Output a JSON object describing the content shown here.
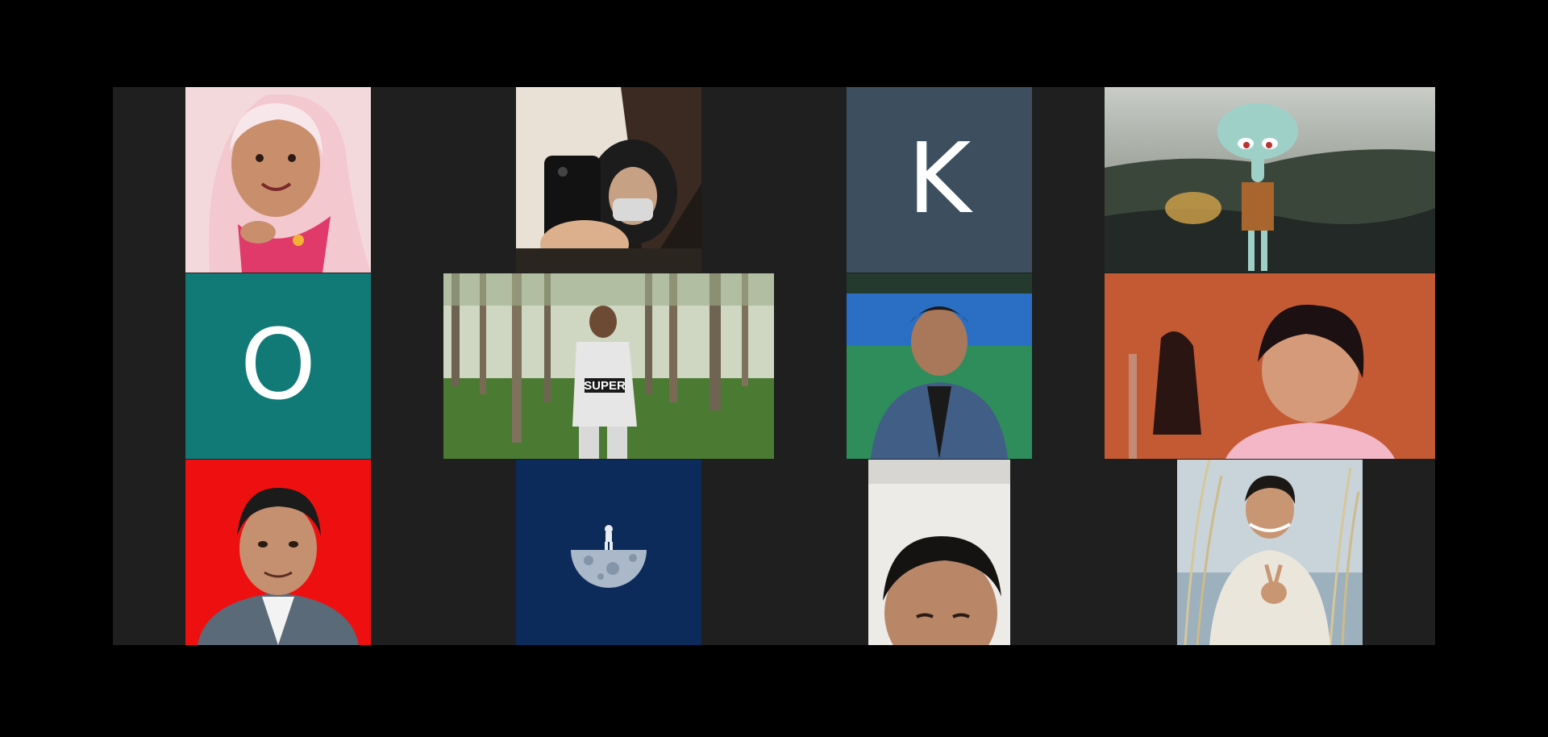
{
  "meeting": {
    "view": "gallery",
    "participants": [
      {
        "id": "p1",
        "kind": "video",
        "description_icon": "person-hijab-video"
      },
      {
        "id": "p2",
        "kind": "video",
        "description_icon": "person-mirror-selfie-video"
      },
      {
        "id": "p3",
        "kind": "avatar-initial",
        "initial": "K",
        "color": "#3d4f5f"
      },
      {
        "id": "p4",
        "kind": "video",
        "description_icon": "cartoon-squid-background"
      },
      {
        "id": "p5",
        "kind": "avatar-initial",
        "initial": "O",
        "color": "#117a77"
      },
      {
        "id": "p6",
        "kind": "video",
        "description_icon": "person-forest-video",
        "shirt_text": "SUPER"
      },
      {
        "id": "p7",
        "kind": "video",
        "description_icon": "person-denim-jacket-video"
      },
      {
        "id": "p8",
        "kind": "video",
        "description_icon": "person-orange-room-video"
      },
      {
        "id": "p9",
        "kind": "video",
        "description_icon": "person-red-background-photo"
      },
      {
        "id": "p10",
        "kind": "video",
        "description_icon": "astronaut-moon-background",
        "color": "#0c2b5a"
      },
      {
        "id": "p11",
        "kind": "video",
        "description_icon": "person-close-face-video"
      },
      {
        "id": "p12",
        "kind": "video",
        "description_icon": "person-peace-sign-video"
      }
    ]
  },
  "colors": {
    "stage_background": "#1f1f1f",
    "outer_background": "#000000",
    "red_backdrop": "#ee1010",
    "teal_avatar": "#117a77",
    "slate_avatar": "#3d4f5f",
    "navy_backdrop": "#0c2b5a"
  }
}
